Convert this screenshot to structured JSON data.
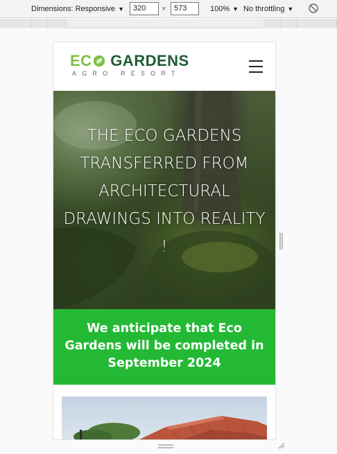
{
  "devtools": {
    "dimensions_label": "Dimensions: Responsive",
    "width_value": "320",
    "height_value": "573",
    "times_sign": "×",
    "zoom": "100%",
    "throttling": "No throttling"
  },
  "site": {
    "logo": {
      "eco": "EC",
      "gardens": "GARDENS",
      "tagline": "AGRO RESORT"
    },
    "hero": {
      "title": "THE ECO GARDENS TRANSFERRED FROM ARCHITECTURAL DRAWINGS INTO REALITY !"
    },
    "banner": {
      "text": "We anticipate that Eco Gardens will be completed in September 2024"
    },
    "colors": {
      "brand_green": "#24b935",
      "logo_light_green": "#7cc143",
      "logo_dark_green": "#1e5c35"
    },
    "icons": {
      "menu": "hamburger-menu-icon",
      "logo_leaf": "leaf-icon"
    }
  }
}
